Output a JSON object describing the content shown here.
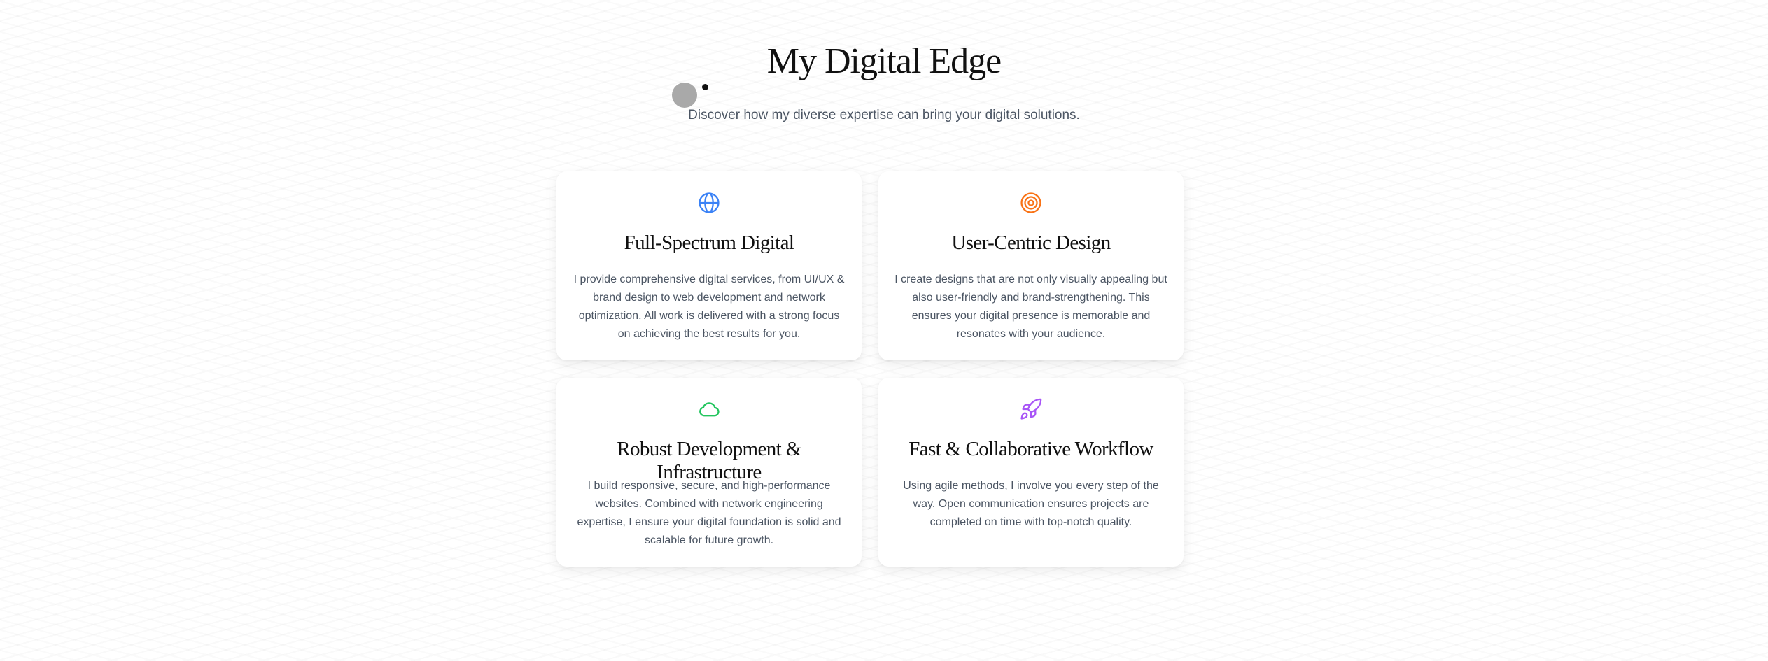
{
  "section": {
    "title": "My Digital Edge",
    "subtitle": "Discover how my diverse expertise can bring your digital solutions."
  },
  "cards": [
    {
      "title": "Full-Spectrum Digital",
      "description": "I provide comprehensive digital services, from UI/UX & brand design to web development and network optimization. All work is delivered with a strong focus on achieving the best results for you.",
      "icon": "globe-icon",
      "color": "#3b82f6"
    },
    {
      "title": "User-Centric Design",
      "description": "I create designs that are not only visually appealing but also user-friendly and brand-strengthening. This ensures your digital presence is memorable and resonates with your audience.",
      "icon": "target-icon",
      "color": "#f97316"
    },
    {
      "title": "Robust Development & Infrastructure",
      "description": "I build responsive, secure, and high-performance websites. Combined with network engineering expertise, I ensure your digital foundation is solid and scalable for future growth.",
      "icon": "cloud-icon",
      "color": "#22c55e"
    },
    {
      "title": "Fast & Collaborative Workflow",
      "description": "Using agile methods, I involve you every step of the way. Open communication ensures projects are completed on time with top-notch quality.",
      "icon": "rocket-icon",
      "color": "#a855f7"
    }
  ],
  "colors": {
    "heading": "#111111",
    "body_text": "#4b5563",
    "background": "#ffffff"
  }
}
